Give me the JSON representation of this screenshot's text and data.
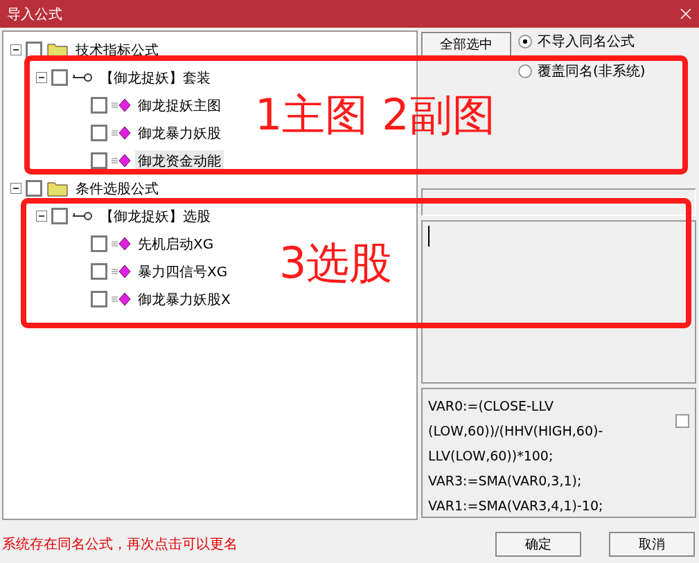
{
  "window": {
    "title": "导入公式"
  },
  "tree": [
    {
      "label": "技术指标公式",
      "kind": "folder",
      "checked": false,
      "expanded": true,
      "selected": false,
      "children": [
        {
          "label": "【御龙捉妖】套装",
          "kind": "group",
          "checked": false,
          "expanded": true,
          "selected": false,
          "children": [
            {
              "label": "御龙捉妖主图",
              "kind": "formula",
              "checked": false,
              "selected": false
            },
            {
              "label": "御龙暴力妖股",
              "kind": "formula",
              "checked": false,
              "selected": false
            },
            {
              "label": "御龙资金动能",
              "kind": "formula",
              "checked": false,
              "selected": true
            }
          ]
        }
      ]
    },
    {
      "label": "条件选股公式",
      "kind": "folder",
      "checked": false,
      "expanded": true,
      "selected": false,
      "children": [
        {
          "label": "【御龙捉妖】选股",
          "kind": "group",
          "checked": false,
          "expanded": true,
          "selected": false,
          "children": [
            {
              "label": "先机启动XG",
              "kind": "formula",
              "checked": false,
              "selected": false
            },
            {
              "label": "暴力四信号XG",
              "kind": "formula",
              "checked": false,
              "selected": false
            },
            {
              "label": "御龙暴力妖股X",
              "kind": "formula",
              "checked": false,
              "selected": false
            }
          ]
        }
      ]
    }
  ],
  "select_all_button": "全部选中",
  "import_options": [
    {
      "label": "不导入同名公式",
      "selected": true
    },
    {
      "label": "覆盖同名(非系统)",
      "selected": false
    }
  ],
  "formula_preview": {
    "lines": [
      "VAR0:=(CLOSE-LLV",
      "(LOW,60))/(HHV(HIGH,60)-",
      "LLV(LOW,60))*100;",
      "VAR3:=SMA(VAR0,3,1);",
      "VAR1:=SMA(VAR3,4,1)-10;"
    ],
    "checked": false
  },
  "status_message": "系统存在同名公式，再次点击可以更名",
  "buttons": [
    "确定",
    "取消"
  ],
  "annotations": [
    {
      "label": "1主图 2副图"
    },
    {
      "label": "3选股"
    }
  ]
}
